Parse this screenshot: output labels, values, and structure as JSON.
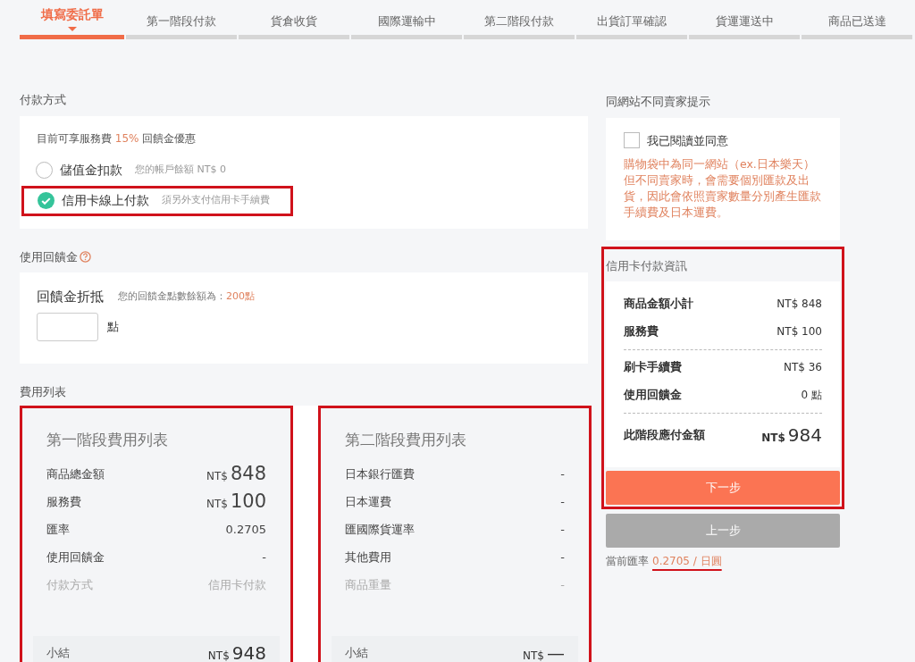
{
  "steps": [
    {
      "label": "填寫委託單",
      "selected": true
    },
    {
      "label": "第一階段付款",
      "selected": false
    },
    {
      "label": "貨倉收貨",
      "selected": false
    },
    {
      "label": "國際運輸中",
      "selected": false
    },
    {
      "label": "第二階段付款",
      "selected": false
    },
    {
      "label": "出貨訂單確認",
      "selected": false
    },
    {
      "label": "貨運運送中",
      "selected": false
    },
    {
      "label": "商品已送達",
      "selected": false
    }
  ],
  "payment": {
    "title": "付款方式",
    "promo_before": "目前可享服務費",
    "promo_highlight": "15%",
    "promo_after": "回饋金優惠",
    "options": [
      {
        "label": "儲值金扣款",
        "note": "您的帳戶餘額 NT$ 0",
        "selected": false,
        "highlighted": false
      },
      {
        "label": "信用卡線上付款",
        "note": "須另外支付信用卡手續費",
        "selected": true,
        "highlighted": true
      }
    ]
  },
  "rebate": {
    "title": "使用回饋金",
    "label": "回饋金折抵",
    "balance_label": "您的回饋金點數餘額為：",
    "balance_value": "200點",
    "unit": "點"
  },
  "fees": {
    "title": "費用列表",
    "tables": [
      {
        "title": "第一階段費用列表",
        "highlighted": true,
        "rows": [
          {
            "label": "商品總金額",
            "kind": "amount",
            "currency": "NT$",
            "amount": "848",
            "muted": false
          },
          {
            "label": "服務費",
            "kind": "amount",
            "currency": "NT$",
            "amount": "100",
            "muted": false
          },
          {
            "label": "匯率",
            "kind": "text",
            "value": "0.2705",
            "muted": false
          },
          {
            "label": "使用回饋金",
            "kind": "text",
            "value": "-",
            "muted": false
          },
          {
            "label": "付款方式",
            "kind": "text",
            "value": "信用卡付款",
            "muted": true
          }
        ],
        "subtotal": {
          "label": "小結",
          "currency": "NT$",
          "amount": "948"
        }
      },
      {
        "title": "第二階段費用列表",
        "highlighted": true,
        "rows": [
          {
            "label": "日本銀行匯費",
            "kind": "text",
            "value": "-",
            "muted": false
          },
          {
            "label": "日本運費",
            "kind": "text",
            "value": "-",
            "muted": false
          },
          {
            "label": "匯國際貨運率",
            "kind": "text",
            "value": "-",
            "muted": false
          },
          {
            "label": "其他費用",
            "kind": "text",
            "value": "-",
            "muted": false
          },
          {
            "label": "商品重量",
            "kind": "text",
            "value": "-",
            "muted": true
          }
        ],
        "subtotal": {
          "label": "小結",
          "currency": "NT$",
          "amount": "—"
        }
      }
    ]
  },
  "notice": {
    "title": "同網站不同賣家提示",
    "checkbox": {
      "label": "我已閱讀並同意",
      "checked": false
    },
    "message": "購物袋中為同一網站（ex.日本樂天）但不同賣家時，會需要個別匯款及出貨，因此會依照賣家數量分別產生匯款手續費及日本運費。"
  },
  "card_info": {
    "title": "信用卡付款資訊",
    "highlighted": true,
    "groups": [
      [
        {
          "label": "商品金額小計",
          "value": "NT$ 848"
        },
        {
          "label": "服務費",
          "value": "NT$ 100"
        }
      ],
      [
        {
          "label": "刷卡手續費",
          "value": "NT$ 36"
        },
        {
          "label": "使用回饋金",
          "value": "0 點"
        }
      ]
    ],
    "total": {
      "label": "此階段應付金額",
      "currency": "NT$",
      "amount": "984"
    }
  },
  "buttons": [
    {
      "label": "下一步",
      "kind": "primary"
    },
    {
      "label": "上一步",
      "kind": "secondary"
    }
  ],
  "rate": {
    "label": "當前匯率",
    "value": "0.2705 / 日圓",
    "underlined": true
  }
}
